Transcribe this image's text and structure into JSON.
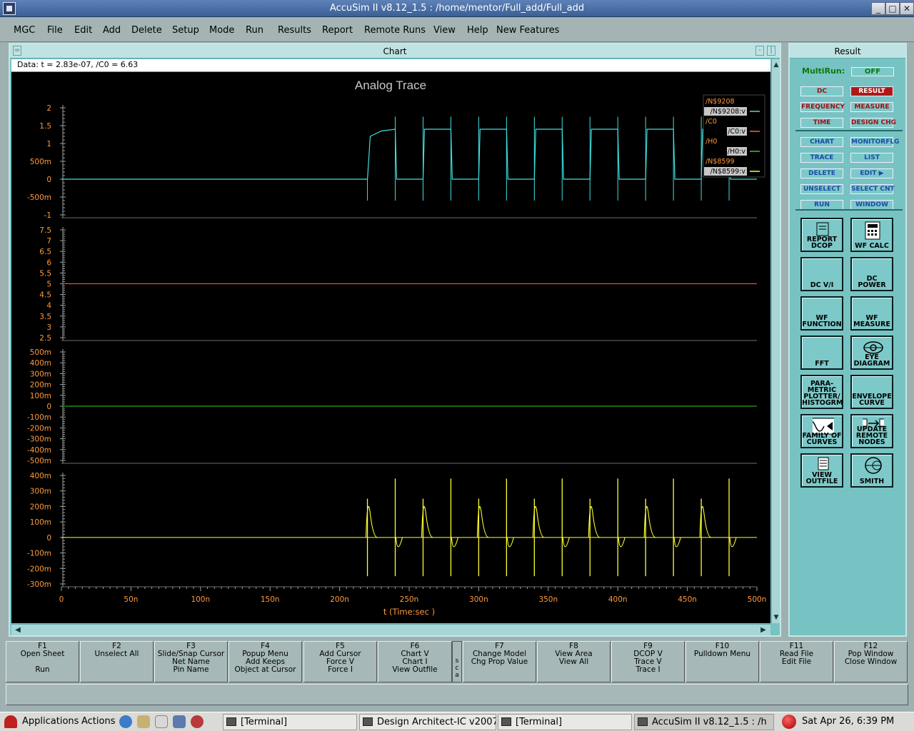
{
  "window": {
    "title": "AccuSim II v8.12_1.5   :   /home/mentor/Full_add/Full_add"
  },
  "menu": [
    "MGC",
    "File",
    "Edit",
    "Add",
    "Delete",
    "Setup",
    "Mode",
    "Run",
    "Results",
    "Report",
    "Remote Runs",
    "View",
    "Help",
    "New Features"
  ],
  "chart": {
    "header": "Chart",
    "data_info": "Data: t = 2.83e-07, /C0 = 6.63",
    "title": "Analog Trace",
    "xlabel": "t (Time:sec )",
    "x_ticks": [
      "0",
      "50n",
      "100n",
      "150n",
      "200n",
      "250n",
      "300n",
      "350n",
      "400n",
      "450n",
      "500n"
    ],
    "legend": [
      {
        "group": "/N$9208",
        "entry": "/N$9208:v",
        "color": "#40e0e0"
      },
      {
        "group": "/C0",
        "entry": "/C0:v",
        "color": "#ff6040"
      },
      {
        "group": "/H0",
        "entry": "/H0:v",
        "color": "#30d030"
      },
      {
        "group": "/N$8599",
        "entry": "/N$8599:v",
        "color": "#ffff30"
      }
    ],
    "panels": [
      {
        "y_ticks": [
          "2",
          "1.5",
          "1",
          "500m",
          "0",
          "-500m",
          "-1"
        ]
      },
      {
        "y_ticks": [
          "7.5",
          "7",
          "6.5",
          "6",
          "5.5",
          "5",
          "4.5",
          "4",
          "3.5",
          "3",
          "2.5"
        ]
      },
      {
        "y_ticks": [
          "500m",
          "400m",
          "300m",
          "200m",
          "100m",
          "0",
          "-100m",
          "-200m",
          "-300m",
          "-400m",
          "-500m"
        ]
      },
      {
        "y_ticks": [
          "400m",
          "300m",
          "200m",
          "100m",
          "0",
          "-100m",
          "-200m",
          "-300m"
        ]
      }
    ]
  },
  "chart_data": {
    "type": "line",
    "title": "Analog Trace",
    "xlabel": "t (Time:sec )",
    "xlim": [
      0,
      5e-07
    ],
    "series": [
      {
        "name": "/N$9208:v",
        "ylim": [
          -1,
          2
        ],
        "x": [
          0,
          2.2e-07,
          2.22e-07,
          2.3e-07,
          2.4e-07,
          2.41e-07,
          2.6e-07,
          2.61e-07,
          2.8e-07,
          2.81e-07,
          3e-07,
          3.01e-07,
          3.2e-07,
          3.21e-07,
          3.4e-07,
          3.41e-07,
          3.6e-07,
          3.61e-07,
          3.8e-07,
          3.81e-07,
          4e-07,
          4.01e-07,
          4.2e-07,
          4.21e-07,
          4.4e-07,
          4.41e-07,
          4.6e-07,
          4.61e-07,
          4.8e-07,
          4.81e-07,
          5e-07
        ],
        "values": [
          0,
          0,
          1.2,
          1.35,
          1.4,
          0,
          0,
          1.4,
          1.4,
          0,
          0,
          1.4,
          1.4,
          0,
          0,
          1.4,
          1.4,
          0,
          0,
          1.4,
          1.4,
          0,
          0,
          1.4,
          1.4,
          0,
          0,
          1.4,
          1.4,
          0,
          0
        ]
      },
      {
        "name": "/C0:v",
        "ylim": [
          2.5,
          7.5
        ],
        "x": [
          0,
          5e-07
        ],
        "values": [
          5,
          5
        ]
      },
      {
        "name": "/H0:v",
        "ylim": [
          -0.5,
          0.5
        ],
        "x": [
          0,
          5e-07
        ],
        "values": [
          0,
          0
        ]
      },
      {
        "name": "/N$8599:v",
        "ylim": [
          -0.3,
          0.4
        ],
        "spike_times": [
          2.2e-07,
          2.4e-07,
          2.6e-07,
          2.8e-07,
          3e-07,
          3.2e-07,
          3.4e-07,
          3.6e-07,
          3.8e-07,
          4e-07,
          4.2e-07,
          4.4e-07,
          4.6e-07,
          4.8e-07
        ],
        "spike_peak": 0.38,
        "spike_trough": -0.25,
        "baseline": 0
      }
    ],
    "grid": false,
    "legend_position": "top-right"
  },
  "result": {
    "header": "Result",
    "multirun_label": "MultiRun:",
    "multirun_value": "OFF",
    "analysis_buttons": [
      "DC",
      "RESULT",
      "FREQUENCY",
      "MEASURE",
      "TIME",
      "DESIGN CHG"
    ],
    "action_buttons": [
      "CHART",
      "MONITORFLG",
      "TRACE",
      "LIST",
      "DELETE",
      "EDIT ▶",
      "UNSELECT",
      "SELECT CNT",
      "RUN",
      "WINDOW"
    ],
    "tools": [
      {
        "label": "REPORT DCOP",
        "icon": "report-icon"
      },
      {
        "label": "WF CALC",
        "icon": "calculator-icon"
      },
      {
        "label": "DC V/I",
        "icon": "none"
      },
      {
        "label": "DC POWER",
        "icon": "none"
      },
      {
        "label": "WF FUNCTION",
        "icon": "none"
      },
      {
        "label": "WF MEASURE",
        "icon": "none"
      },
      {
        "label": "FFT",
        "icon": "none"
      },
      {
        "label": "EYE DIAGRAM",
        "icon": "eye-icon"
      },
      {
        "label": "PARA-METRIC PLOTTER/ HISTOGRM",
        "icon": "none"
      },
      {
        "label": "ENVELOPE CURVE",
        "icon": "none"
      },
      {
        "label": "FAMILY OF CURVES",
        "icon": "waveform-icon"
      },
      {
        "label": "UPDATE REMOTE NODES",
        "icon": "arrows-icon"
      },
      {
        "label": "VIEW OUTFILE",
        "icon": "document-icon"
      },
      {
        "label": "SMITH",
        "icon": "smith-chart-icon"
      }
    ]
  },
  "fkeys": [
    {
      "fn": "F1",
      "lines": [
        "Open Sheet",
        "",
        "Run"
      ]
    },
    {
      "fn": "F2",
      "lines": [
        "Unselect All",
        "",
        ""
      ]
    },
    {
      "fn": "F3",
      "lines": [
        "Slide/Snap Cursor",
        "Net Name",
        "Pin Name"
      ]
    },
    {
      "fn": "F4",
      "lines": [
        "Popup Menu",
        "Add Keeps",
        "Object at Cursor"
      ]
    },
    {
      "fn": "F5",
      "lines": [
        "Add Cursor",
        "Force V",
        "Force I"
      ]
    },
    {
      "fn": "F6",
      "lines": [
        "Chart V",
        "Chart I",
        "View Outfile"
      ]
    },
    {
      "fn": "F7",
      "lines": [
        "Change Model",
        "Chg Prop Value",
        ""
      ]
    },
    {
      "fn": "F8",
      "lines": [
        "View Area",
        "View All",
        ""
      ]
    },
    {
      "fn": "F9",
      "lines": [
        "DCOP V",
        "Trace V",
        "Trace I"
      ]
    },
    {
      "fn": "F10",
      "lines": [
        "Pulldown Menu",
        "",
        ""
      ]
    },
    {
      "fn": "F11",
      "lines": [
        "Read File",
        "Edit File",
        ""
      ]
    },
    {
      "fn": "F12",
      "lines": [
        "Pop Window",
        "Close Window",
        ""
      ]
    }
  ],
  "sca_label": "s c a",
  "taskbar": {
    "applications": "Applications",
    "actions": "Actions",
    "tasks": [
      "[Terminal]",
      "Design Architect-IC v2007.1_",
      "[Terminal]",
      "AccuSim II v8.12_1.5   :   /h"
    ],
    "clock": "Sat Apr 26,  6:39 PM"
  }
}
